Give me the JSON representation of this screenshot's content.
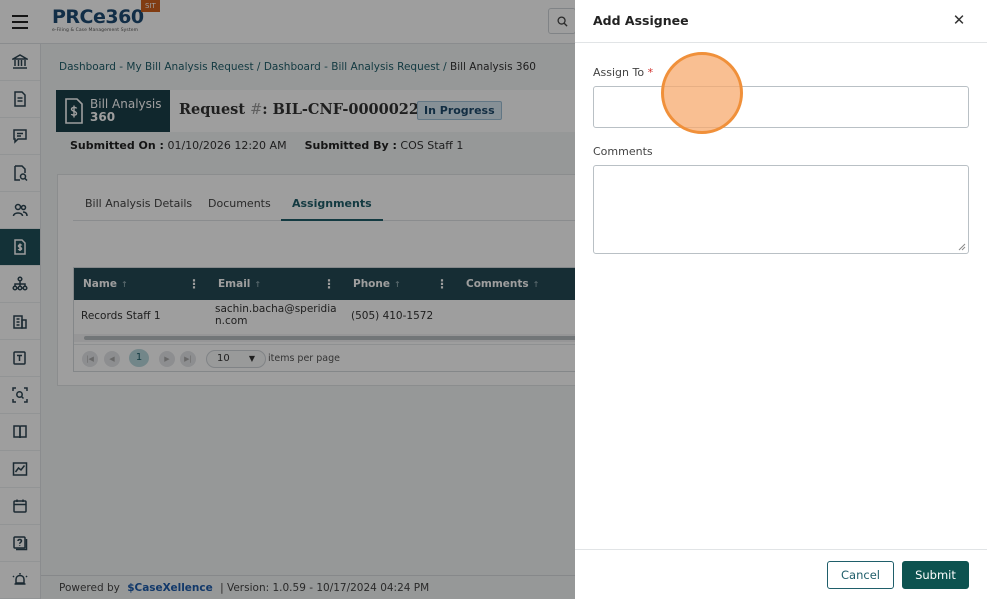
{
  "header": {
    "logo_text": "PRCe360",
    "logo_subtitle": "e-Filing & Case Management System",
    "env_badge": "SIT",
    "menu_icon": "hamburger-icon",
    "search_icon": "search-icon"
  },
  "sidebar": {
    "items": [
      {
        "icon": "bank-icon"
      },
      {
        "icon": "document-icon"
      },
      {
        "icon": "chat-icon"
      },
      {
        "icon": "document-search-icon"
      },
      {
        "icon": "users-icon"
      },
      {
        "icon": "bill-dollar-icon",
        "active": true
      },
      {
        "icon": "org-chart-icon"
      },
      {
        "icon": "building-icon"
      },
      {
        "icon": "template-icon"
      },
      {
        "icon": "scan-search-icon"
      },
      {
        "icon": "book-icon"
      },
      {
        "icon": "chart-icon"
      },
      {
        "icon": "calendar-icon"
      },
      {
        "icon": "help-icon"
      },
      {
        "icon": "alarm-icon"
      }
    ]
  },
  "breadcrumb": {
    "link1": "Dashboard - My Bill Analysis Request",
    "sep1": " / ",
    "link2": "Dashboard - Bill Analysis Request",
    "sep2": " / ",
    "current": "Bill Analysis 360"
  },
  "request": {
    "tag_line1": "Bill Analysis",
    "tag_line2": "360",
    "title_prefix": "Request ",
    "title_hash": "#",
    "title_id": ": BIL-CNF-0000022-26",
    "status": "In Progress",
    "submitted_on_label": "Submitted On :",
    "submitted_on_value": " 01/10/2026 12:20 AM",
    "submitted_by_label": "Submitted By :",
    "submitted_by_value": " COS Staff 1"
  },
  "tabs": [
    {
      "label": "Bill Analysis Details"
    },
    {
      "label": "Documents"
    },
    {
      "label": "Assignments",
      "active": true
    }
  ],
  "grid": {
    "columns": [
      "Name",
      "Email",
      "Phone",
      "Comments"
    ],
    "rows": [
      {
        "name": "Records Staff 1",
        "email_line1": "sachin.bacha@speridia",
        "email_line2": "n.com",
        "phone": "(505) 410-1572",
        "comments": ""
      }
    ],
    "pager": {
      "current_page": "1",
      "page_size": "10",
      "items_per_page_label": "items per page"
    }
  },
  "footer": {
    "powered_by": "Powered by",
    "brand": "CaseXellence",
    "version": "|  Version: 1.0.59 - 10/17/2024 04:24 PM"
  },
  "drawer": {
    "title": "Add Assignee",
    "close_icon": "close-icon",
    "assign_to_label": "Assign To",
    "required_mark": "*",
    "assign_to_value": "",
    "comments_label": "Comments",
    "comments_value": "",
    "cancel_label": "Cancel",
    "submit_label": "Submit"
  }
}
